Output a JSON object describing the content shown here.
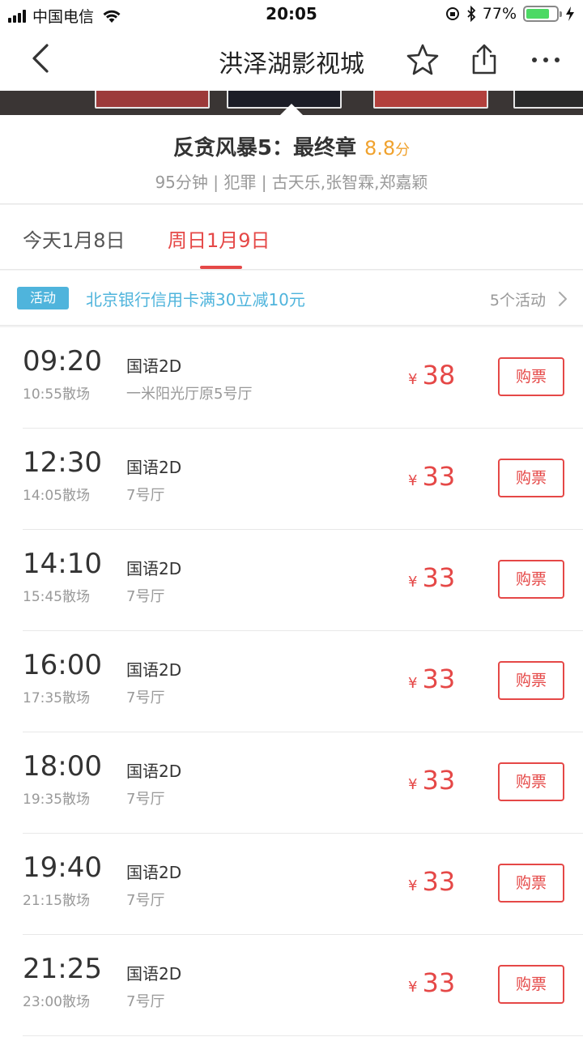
{
  "status_bar": {
    "carrier": "中国电信",
    "time": "20:05",
    "battery_percent": "77%",
    "battery_level": 0.77
  },
  "nav": {
    "title": "洪泽湖影视城",
    "icons": [
      "back-chevron-icon",
      "star-icon",
      "share-icon",
      "more-icon"
    ]
  },
  "movie": {
    "title": "反贪风暴5：最终章",
    "score": "8.8",
    "score_unit": "分",
    "meta": "95分钟 | 犯罪 | 古天乐,张智霖,郑嘉颖"
  },
  "date_tabs": [
    {
      "label": "今天1月8日",
      "active": false
    },
    {
      "label": "周日1月9日",
      "active": true
    }
  ],
  "promo": {
    "badge": "活动",
    "text": "北京银行信用卡满30立减10元",
    "count": "5个活动"
  },
  "currency": "¥",
  "buy_label": "购票",
  "showtimes": [
    {
      "start": "09:20",
      "end": "10:55散场",
      "lang": "国语2D",
      "hall": "一米阳光厅原5号厅",
      "price": "38"
    },
    {
      "start": "12:30",
      "end": "14:05散场",
      "lang": "国语2D",
      "hall": "7号厅",
      "price": "33"
    },
    {
      "start": "14:10",
      "end": "15:45散场",
      "lang": "国语2D",
      "hall": "7号厅",
      "price": "33"
    },
    {
      "start": "16:00",
      "end": "17:35散场",
      "lang": "国语2D",
      "hall": "7号厅",
      "price": "33"
    },
    {
      "start": "18:00",
      "end": "19:35散场",
      "lang": "国语2D",
      "hall": "7号厅",
      "price": "33"
    },
    {
      "start": "19:40",
      "end": "21:15散场",
      "lang": "国语2D",
      "hall": "7号厅",
      "price": "33"
    },
    {
      "start": "21:25",
      "end": "23:00散场",
      "lang": "国语2D",
      "hall": "7号厅",
      "price": "33"
    }
  ],
  "colors": {
    "accent_red": "#e54847",
    "score_orange": "#f0a22e",
    "promo_blue": "#4fb4dc",
    "battery_green": "#4cd964"
  }
}
